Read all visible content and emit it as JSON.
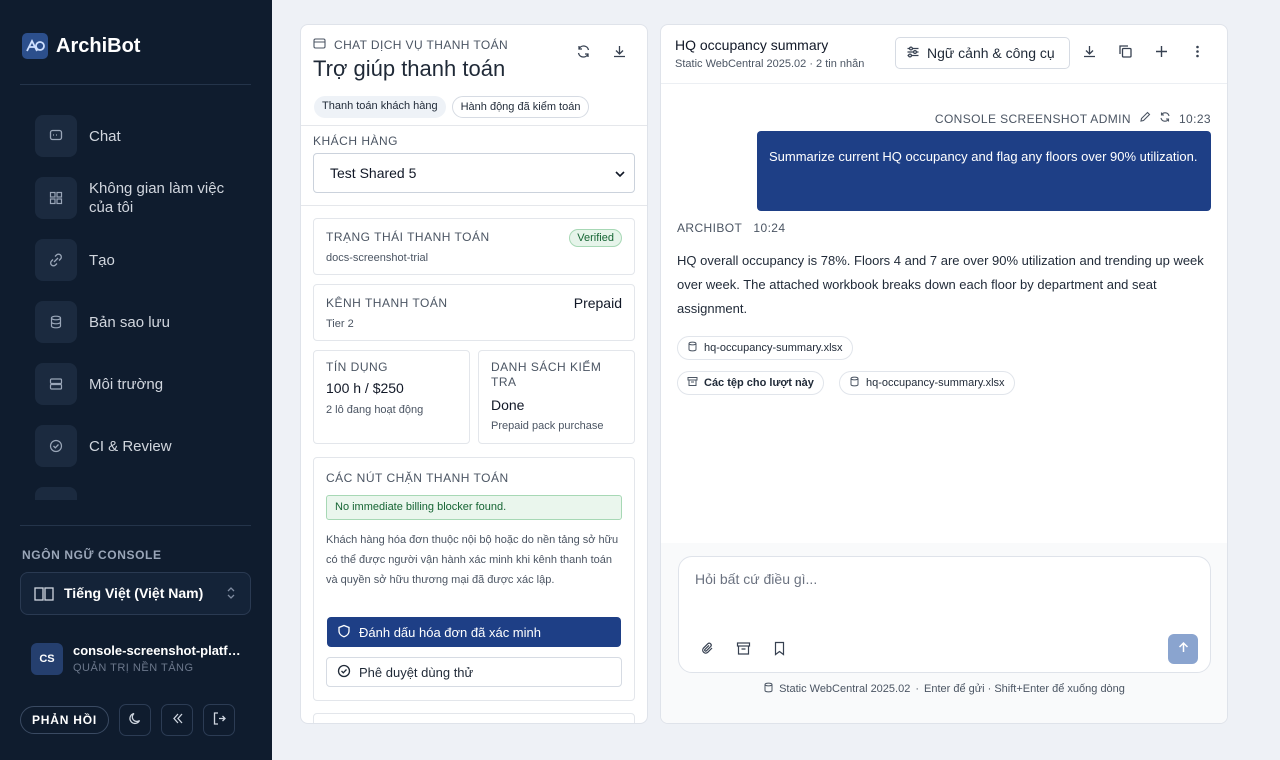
{
  "sidebar": {
    "brand": "ArchiBot",
    "nav": [
      {
        "label": "Chat",
        "icon": "chat-bubble-icon"
      },
      {
        "label": "Không gian làm việc của tôi",
        "icon": "grid-icon"
      },
      {
        "label": "Tạo",
        "icon": "link-icon"
      },
      {
        "label": "Bản sao lưu",
        "icon": "database-icon"
      },
      {
        "label": "Môi trường",
        "icon": "server-icon"
      },
      {
        "label": "CI & Review",
        "icon": "check-circle-icon"
      }
    ],
    "language_title": "NGÔN NGỮ CONSOLE",
    "language_value": "Tiếng Việt (Việt Nam)",
    "user_initials": "CS",
    "user_name": "console-screenshot-platform",
    "user_role": "QUẢN TRỊ NỀN TẢNG",
    "feedback_label": "PHẢN HỒI"
  },
  "billing": {
    "kicker": "CHAT DỊCH VỤ THANH TOÁN",
    "title": "Trợ giúp thanh toán",
    "chips": [
      "Thanh toán khách hàng",
      "Hành động đã kiểm toán"
    ],
    "customer_label": "KHÁCH HÀNG",
    "customer_value": "Test Shared 5",
    "status_label": "TRẠNG THÁI THANH TOÁN",
    "status_badge": "Verified",
    "status_sub": "docs-screenshot-trial",
    "channel_label": "KÊNH THANH TOÁN",
    "channel_value": "Prepaid",
    "channel_sub": "Tier 2",
    "credit_label": "TÍN DỤNG",
    "credit_value": "100 h / $250",
    "credit_sub": "2 lô đang hoạt động",
    "checklist_label": "DANH SÁCH KIỂM TRA",
    "checklist_value": "Done",
    "checklist_sub": "Prepaid pack purchase",
    "blockers_label": "CÁC NÚT CHẶN THANH TOÁN",
    "blockers_notice": "No immediate billing blocker found.",
    "blockers_text": "Khách hàng hóa đơn thuộc nội bộ hoặc do nền tảng sở hữu có thể được người vận hành xác minh khi kênh thanh toán và quyền sở hữu thương mại đã được xác lập.",
    "mark_verified_label": "Đánh dấu hóa đơn đã xác minh",
    "approve_trial_label": "Phê duyệt dùng thử"
  },
  "chat": {
    "title": "HQ occupancy summary",
    "subtitle": "Static WebCentral 2025.02 · 2 tin nhắn",
    "context_label": "Ngữ cảnh & công cụ",
    "user_sender": "CONSOLE SCREENSHOT ADMIN",
    "user_time": "10:23",
    "user_message": "Summarize current HQ occupancy and flag any floors over 90% utilization.",
    "bot_sender": "ARCHIBOT",
    "bot_time": "10:24",
    "bot_message": "HQ overall occupancy is 78%. Floors 4 and 7 are over 90% utilization and trending up week over week. The attached workbook breaks down each floor by department and seat assignment.",
    "attachment": "hq-occupancy-summary.xlsx",
    "turn_files_label": "Các tệp cho lượt này",
    "turn_file": "hq-occupancy-summary.xlsx",
    "composer_placeholder": "Hỏi bất cứ điều gì...",
    "footer_env": "Static WebCentral 2025.02",
    "footer_sep": "·",
    "footer_hint": "Enter để gửi · Shift+Enter để xuống dòng"
  },
  "colors": {
    "sidebar_bg": "#0f1c2e",
    "primary": "#1e3f86",
    "verified": "#166534",
    "send_disabled": "#8aa4cf"
  }
}
